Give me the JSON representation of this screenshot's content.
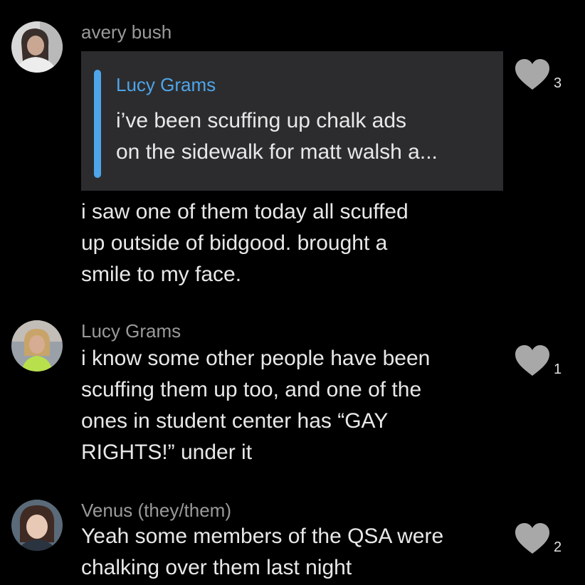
{
  "colors": {
    "background": "#000000",
    "quote_bg": "#2c2c2e",
    "quote_accent": "#4ea5ea",
    "author_gray": "#9a9a9a",
    "heart_gray": "#a8a8a8"
  },
  "comments": [
    {
      "author": "avery bush",
      "quote": {
        "author": "Lucy Grams",
        "lines": [
          "i’ve been scuffing up chalk ads",
          "on the sidewalk for matt walsh a..."
        ]
      },
      "lines": [
        "i saw one of them today all scuffed",
        "up outside of bidgood. brought a",
        "smile to my face."
      ],
      "like_icon": "heart-icon",
      "likes": "3"
    },
    {
      "author": "Lucy Grams",
      "lines": [
        "i know some other people have been",
        "scuffing them up too, and one of the",
        "ones in student center has “GAY",
        "RIGHTS!” under it"
      ],
      "like_icon": "heart-icon",
      "likes": "1"
    },
    {
      "author": "Venus (they/them)",
      "lines": [
        "Yeah some members of the QSA were",
        "chalking over them last night"
      ],
      "like_icon": "heart-icon",
      "likes": "2"
    }
  ]
}
